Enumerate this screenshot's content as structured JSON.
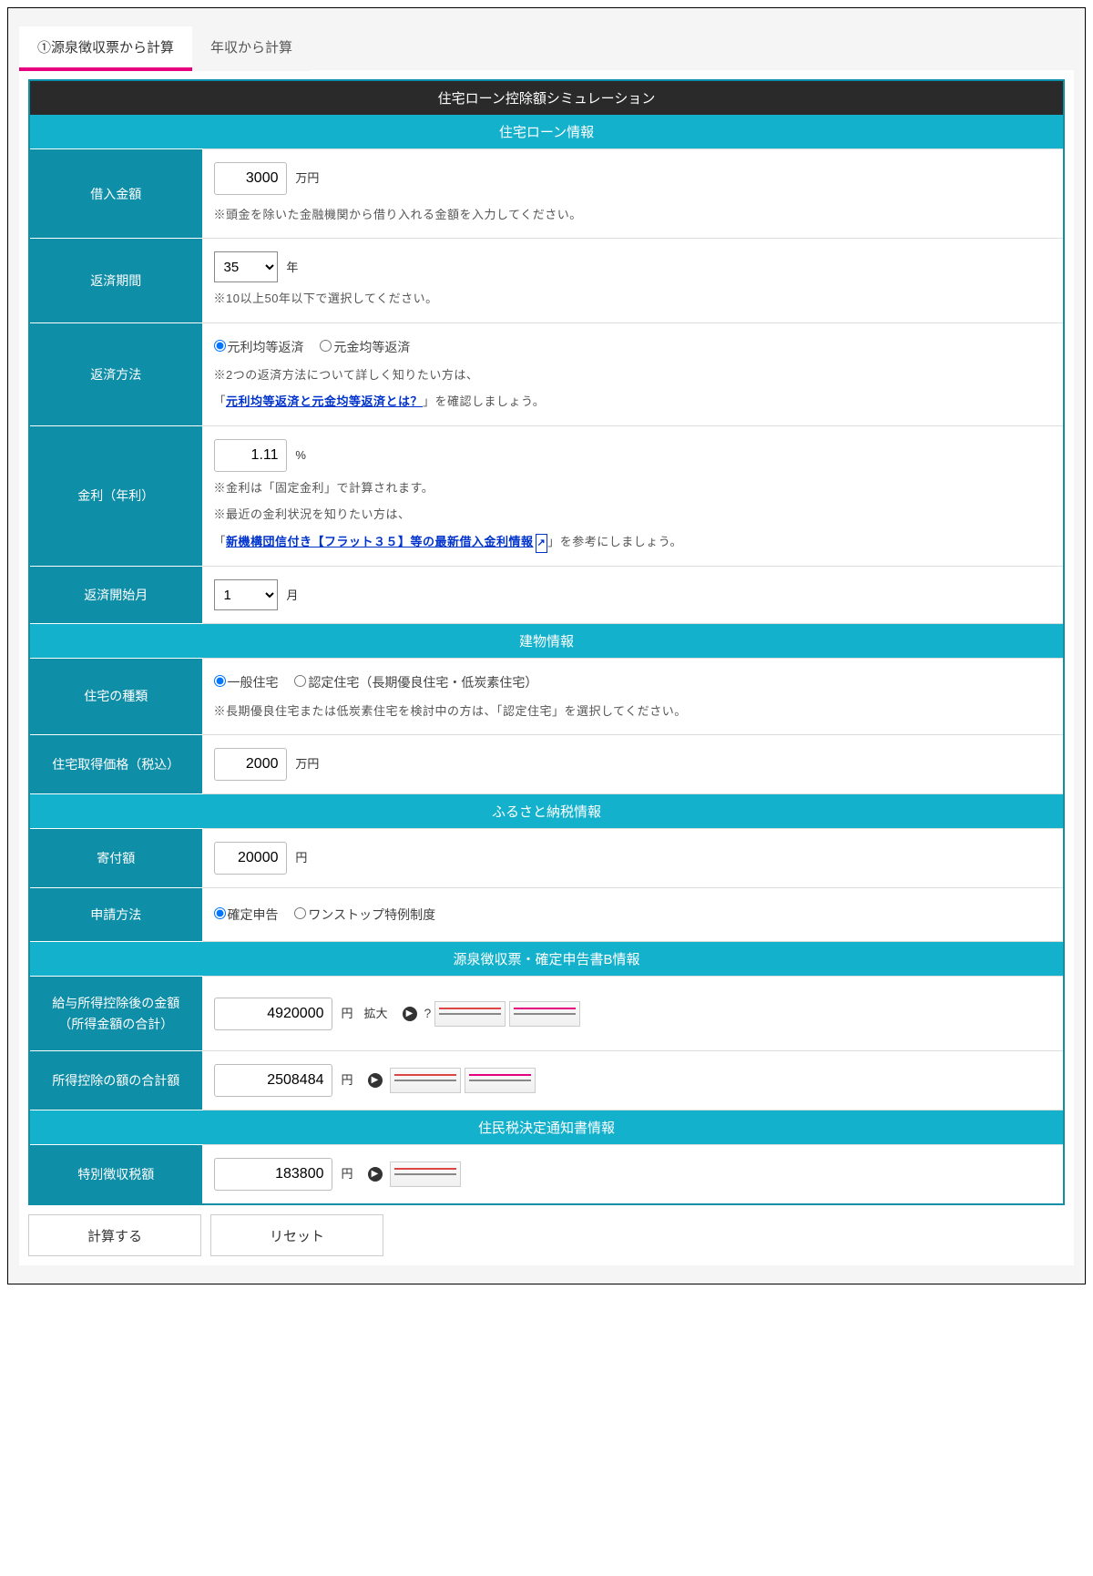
{
  "tabs": {
    "t1": "①源泉徴収票から計算",
    "t2": "年収から計算"
  },
  "title": "住宅ローン控除額シミュレーション",
  "sections": {
    "loan": "住宅ローン情報",
    "building": "建物情報",
    "furusato": "ふるさと納税情報",
    "gensen": "源泉徴収票・確定申告書B情報",
    "jumin": "住民税決定通知書情報"
  },
  "labels": {
    "amount": "借入金額",
    "period": "返済期間",
    "method": "返済方法",
    "rate": "金利（年利）",
    "startMonth": "返済開始月",
    "houseType": "住宅の種類",
    "housePrice": "住宅取得価格（税込）",
    "donation": "寄付額",
    "applyMethod": "申請方法",
    "income": "給与所得控除後の金額\n（所得金額の合計）",
    "deduction": "所得控除の額の合計額",
    "residentTax": "特別徴収税額"
  },
  "values": {
    "amount": "3000",
    "period": "35",
    "rate": "1.11",
    "startMonth": "1",
    "housePrice": "2000",
    "donation": "20000",
    "income": "4920000",
    "deduction": "2508484",
    "residentTax": "183800"
  },
  "units": {
    "manYen": "万円",
    "year": "年",
    "percent": "%",
    "month": "月",
    "yen": "円"
  },
  "notes": {
    "amount": "※頭金を除いた金融機関から借り入れる金額を入力してください。",
    "period": "※10以上50年以下で選択してください。",
    "methodIntro": "※2つの返済方法について詳しく知りたい方は、",
    "methodLinkPre": "「",
    "methodLink": "元利均等返済と元金均等返済とは？",
    "methodLinkPost": "」を確認しましょう。",
    "rate1": "※金利は「固定金利」で計算されます。",
    "rate2": "※最近の金利状況を知りたい方は、",
    "rateLinkPre": "「",
    "rateLink": "新機構団信付き【フラット３５】等の最新借入金利情報",
    "rateLinkPost": "」を参考にしましょう。",
    "houseType": "※長期優良住宅または低炭素住宅を検討中の方は、「認定住宅」を選択してください。",
    "zoom": "拡大"
  },
  "radios": {
    "method1": "元利均等返済",
    "method2": "元金均等返済",
    "house1": "一般住宅",
    "house2": "認定住宅（長期優良住宅・低炭素住宅）",
    "apply1": "確定申告",
    "apply2": "ワンストップ特例制度"
  },
  "buttons": {
    "calc": "計算する",
    "reset": "リセット"
  }
}
